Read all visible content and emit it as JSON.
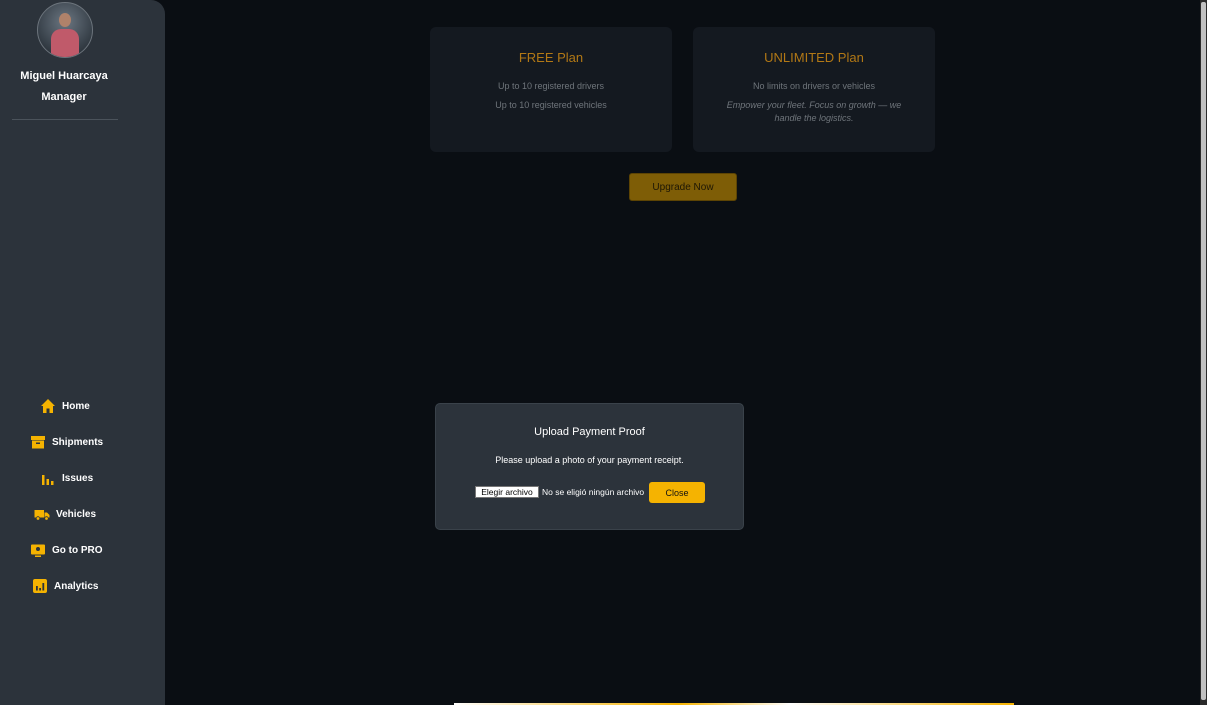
{
  "user": {
    "name": "Miguel Huarcaya",
    "role": "Manager"
  },
  "nav": [
    {
      "label": "Home",
      "icon": "home-icon"
    },
    {
      "label": "Shipments",
      "icon": "box-icon"
    },
    {
      "label": "Issues",
      "icon": "bar-chart-icon"
    },
    {
      "label": "Vehicles",
      "icon": "truck-icon"
    },
    {
      "label": "Go to PRO",
      "icon": "monitor-icon"
    },
    {
      "label": "Analytics",
      "icon": "analytics-icon"
    }
  ],
  "plans": [
    {
      "title": "FREE Plan",
      "lines": [
        "Up to 10 registered drivers",
        "Up to 10 registered vehicles"
      ]
    },
    {
      "title": "UNLIMITED Plan",
      "lines": [
        "No limits on drivers or vehicles",
        "Empower your fleet. Focus on growth — we handle the logistics."
      ]
    }
  ],
  "upgrade": {
    "label": "Upgrade Now"
  },
  "modal": {
    "title": "Upload Payment Proof",
    "text": "Please upload a photo of your payment receipt.",
    "file_button": "Elegir archivo",
    "file_status": "No se eligió ningún archivo",
    "close_label": "Close"
  },
  "colors": {
    "accent": "#f5b301",
    "sidebar": "#2c333b",
    "background": "#0a0e13"
  }
}
